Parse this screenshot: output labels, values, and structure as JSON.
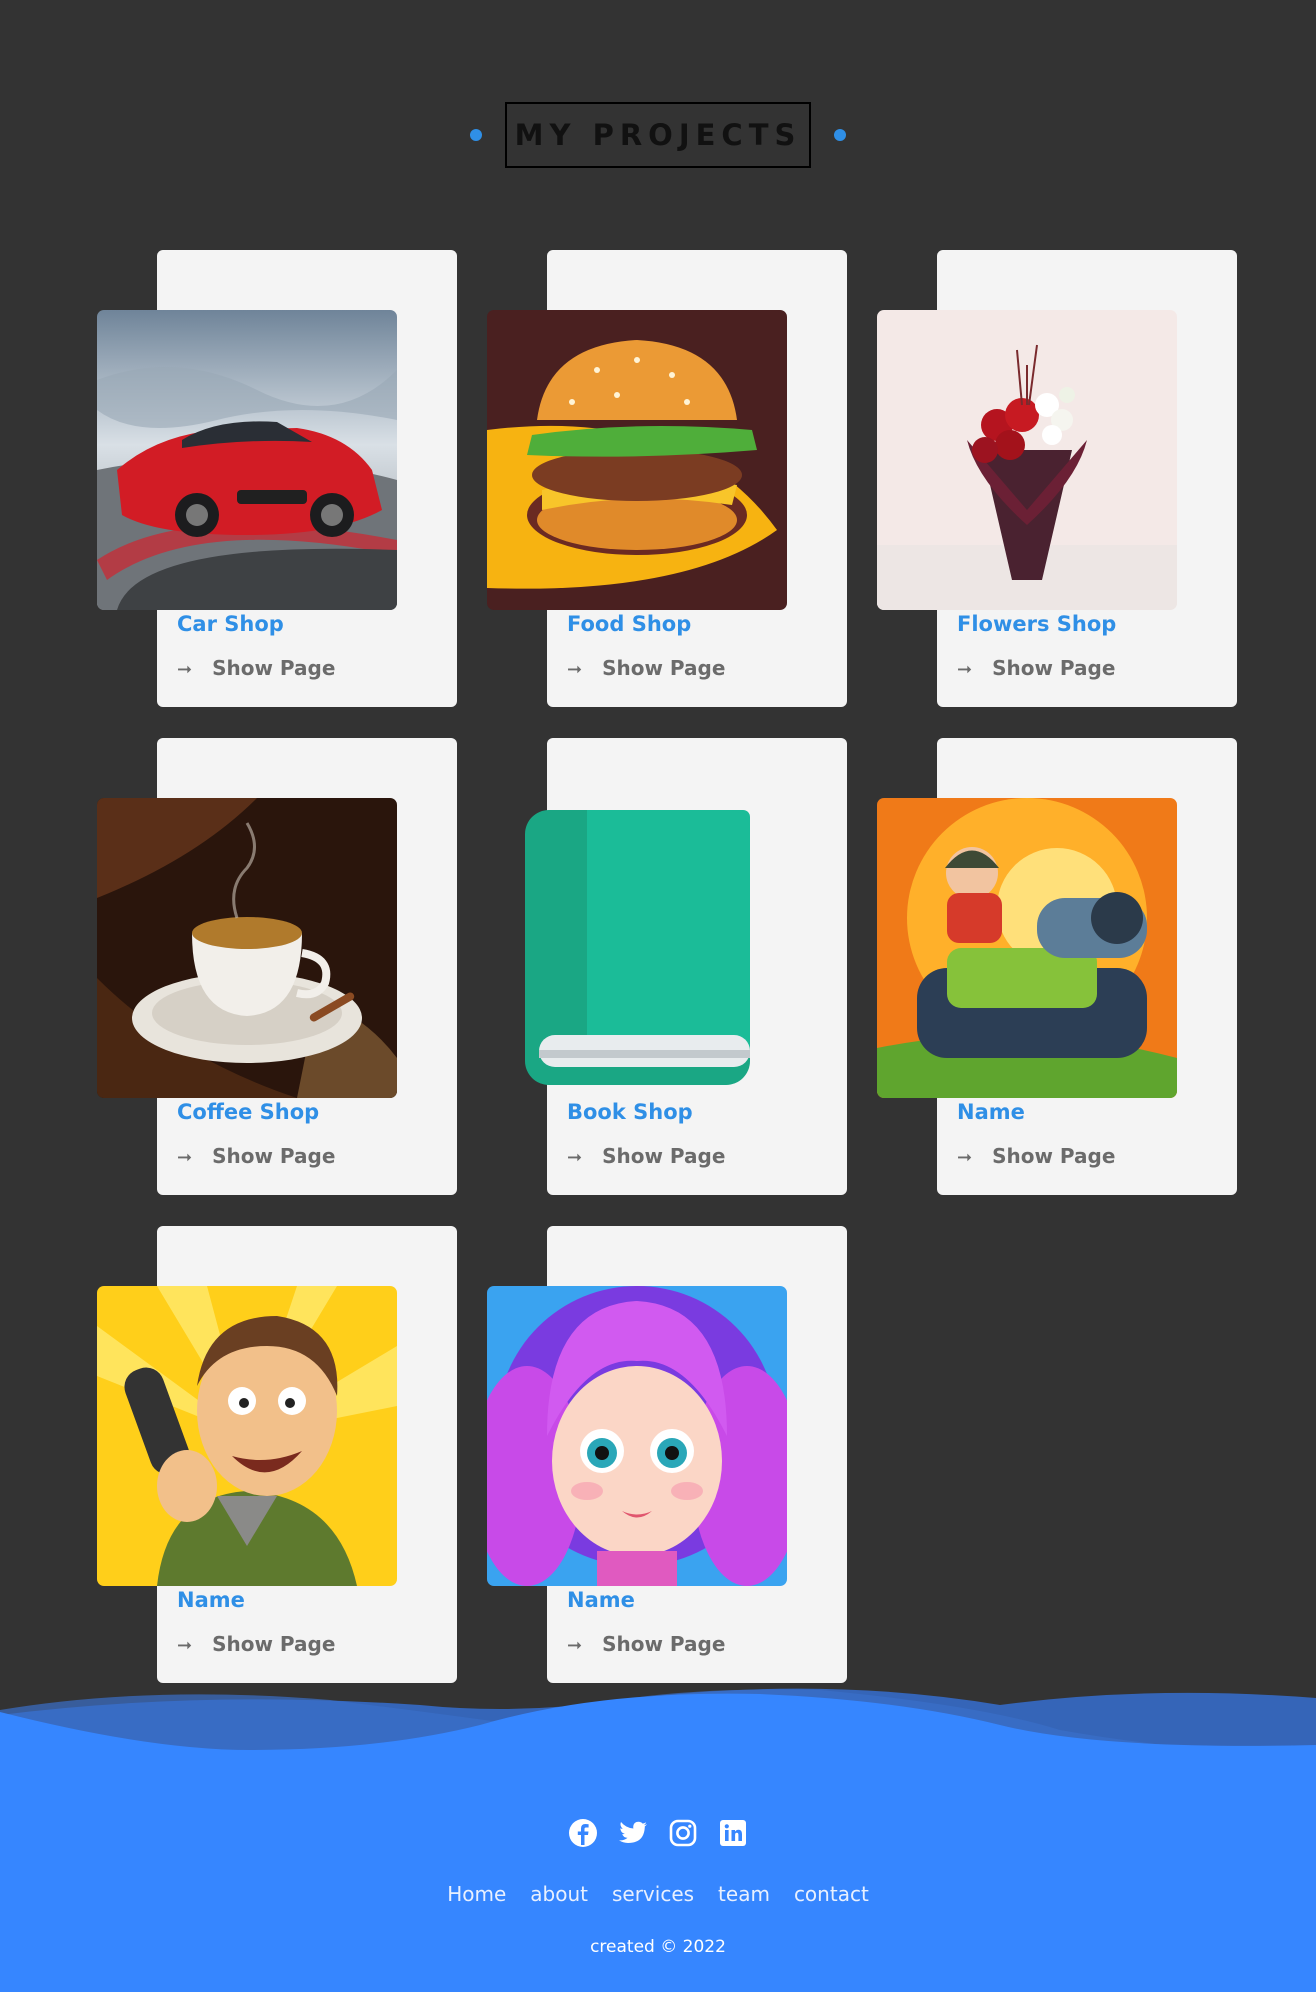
{
  "section": {
    "title": "MY PROJECTS",
    "accent_color": "#2f8fe6"
  },
  "projects": [
    {
      "name": "Car Shop",
      "link": "Show Page",
      "image": "red-sports-car"
    },
    {
      "name": "Food Shop",
      "link": "Show Page",
      "image": "burger"
    },
    {
      "name": "Flowers Shop",
      "link": "Show Page",
      "image": "flower-bouquet"
    },
    {
      "name": "Coffee Shop",
      "link": "Show Page",
      "image": "coffee-cup"
    },
    {
      "name": "Book Shop",
      "link": "Show Page",
      "image": "green-book-icon"
    },
    {
      "name": "Name",
      "link": "Show Page",
      "image": "cartoon-tank-game"
    },
    {
      "name": "Name",
      "link": "Show Page",
      "image": "cartoon-man-phone"
    },
    {
      "name": "Name",
      "link": "Show Page",
      "image": "cartoon-girl-purple-hair"
    }
  ],
  "footer": {
    "social_icons": [
      "facebook-icon",
      "twitter-icon",
      "instagram-icon",
      "linkedin-icon"
    ],
    "nav": [
      "Home",
      "about",
      "services",
      "team",
      "contact"
    ],
    "copyright": "created © 2022",
    "background_color": "#3686ff"
  }
}
